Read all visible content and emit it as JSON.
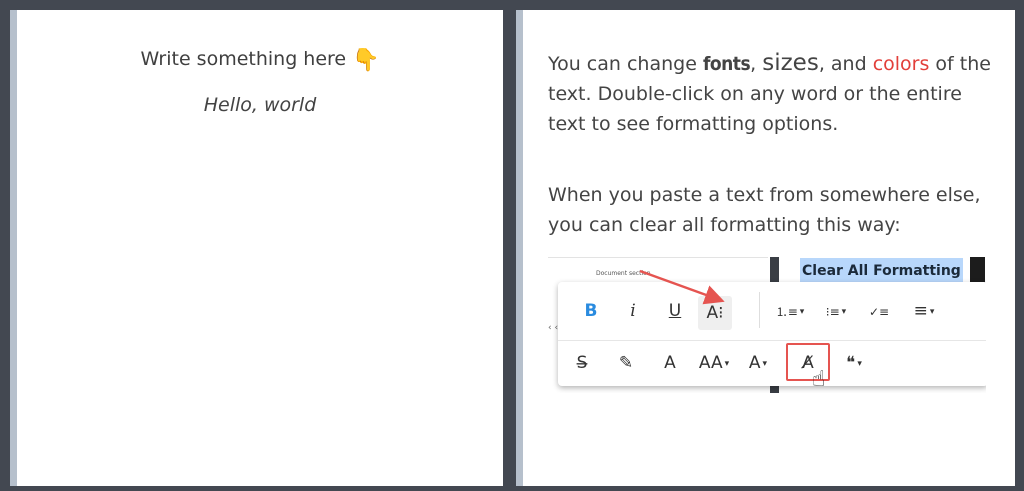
{
  "left_panel": {
    "prompt": "Write something here",
    "prompt_emoji": "👇",
    "sample_text": "Hello, world"
  },
  "right_panel": {
    "para1": {
      "t1": "You can change ",
      "fonts": "fonts",
      "t2": ", ",
      "sizes": "sizes",
      "t3": ", and ",
      "colors": "colors",
      "t4": " of the text. Double-click on any word or the entire text to see formatting options."
    },
    "para2": "When you paste a text from somewhere else, you can clear all formatting this way:",
    "image": {
      "doc_section_label": "Document section",
      "clear_label": "Clear All Formatting",
      "left_fragment": "‹ ‹",
      "row1": [
        {
          "icon": "bold-icon",
          "glyph": "B"
        },
        {
          "icon": "italic-icon",
          "glyph": "i"
        },
        {
          "icon": "underline-icon",
          "glyph": "U"
        },
        {
          "icon": "text-size-icon",
          "glyph": "A⁝"
        },
        {
          "icon": "ordered-list-icon",
          "glyph": "⒈≡"
        },
        {
          "icon": "bullet-list-icon",
          "glyph": "⁝≡"
        },
        {
          "icon": "checklist-icon",
          "glyph": "✓≡"
        },
        {
          "icon": "align-icon",
          "glyph": "≡"
        }
      ],
      "row2": [
        {
          "icon": "strikethrough-icon",
          "glyph": "S̶"
        },
        {
          "icon": "highlighter-icon",
          "glyph": "✎"
        },
        {
          "icon": "text-color-icon",
          "glyph": "A"
        },
        {
          "icon": "font-size-icon",
          "glyph": "AA"
        },
        {
          "icon": "font-family-icon",
          "glyph": "A"
        },
        {
          "icon": "clear-formatting-icon",
          "glyph": "A̸"
        },
        {
          "icon": "quote-icon",
          "glyph": "❝"
        }
      ]
    }
  },
  "colors": {
    "background": "#434851",
    "panel_border": "#b6c0cc",
    "accent_red": "#e23f3a",
    "bold_blue": "#2a8bdf",
    "highlight_blue": "#b8d7fb"
  }
}
